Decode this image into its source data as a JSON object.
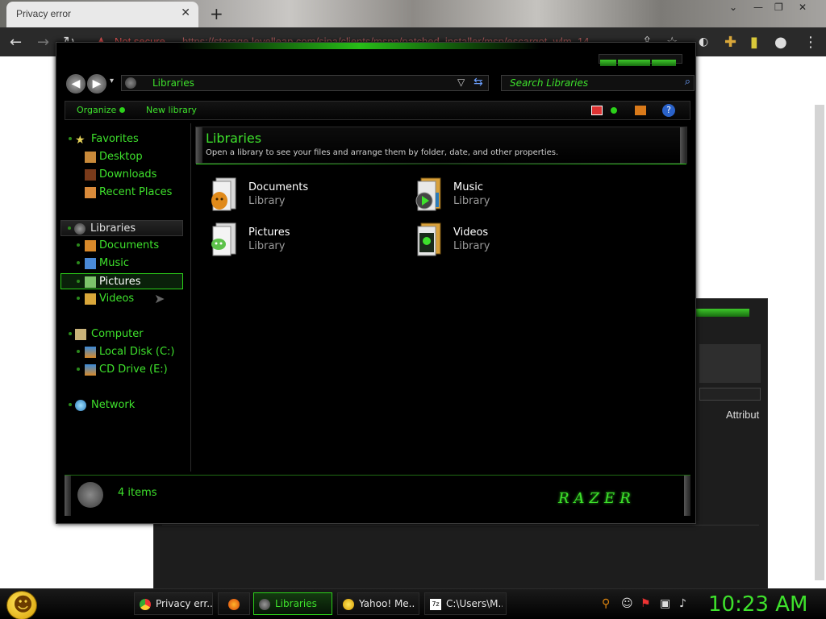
{
  "browser": {
    "tab_title": "Privacy error",
    "not_secure_label": "Not secure",
    "url": "https://storage.levelleap.com/sipa/clients/mspp/patched_installer/msp/escargot_wlm_14..."
  },
  "background_window": {
    "attribute_label": "Attribut"
  },
  "explorer": {
    "address": "Libraries",
    "search_placeholder": "Search Libraries",
    "toolbar": {
      "organize": "Organize",
      "new_library": "New library"
    },
    "nav": {
      "favorites": "Favorites",
      "desktop": "Desktop",
      "downloads": "Downloads",
      "recent_places": "Recent Places",
      "libraries": "Libraries",
      "documents": "Documents",
      "music": "Music",
      "pictures": "Pictures",
      "videos": "Videos",
      "computer": "Computer",
      "local_disk": "Local Disk (C:)",
      "cd_drive": "CD Drive (E:)",
      "network": "Network"
    },
    "content": {
      "title": "Libraries",
      "subtitle": "Open a library to see your files and arrange them by folder, date, and other properties.",
      "tiles": [
        {
          "name": "Documents",
          "type": "Library"
        },
        {
          "name": "Music",
          "type": "Library"
        },
        {
          "name": "Pictures",
          "type": "Library"
        },
        {
          "name": "Videos",
          "type": "Library"
        }
      ]
    },
    "status": {
      "count": "4 items",
      "logo_text": "RAZER"
    }
  },
  "taskbar": {
    "tasks": [
      {
        "label": "Privacy err..."
      },
      {
        "label": ""
      },
      {
        "label": "Libraries"
      },
      {
        "label": "Yahoo! Me..."
      },
      {
        "label": "C:\\Users\\M..."
      }
    ],
    "clock": "10:23 AM"
  },
  "colors": {
    "accent": "#3ee12c",
    "window_bg": "#000000",
    "text_muted": "#9a9a9a"
  }
}
